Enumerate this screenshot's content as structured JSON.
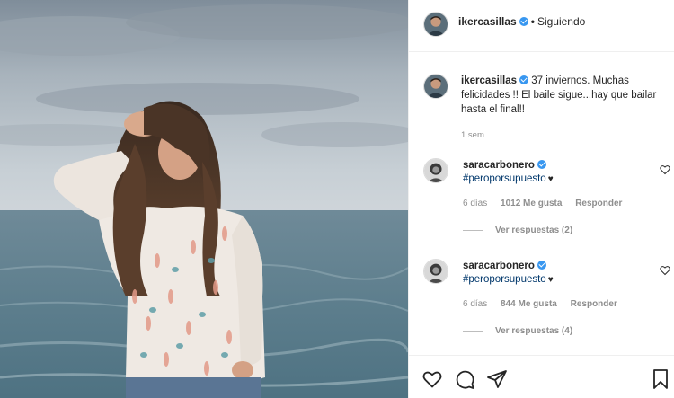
{
  "post": {
    "header": {
      "username": "ikercasillas",
      "separator": "•",
      "follow_status": "Siguiendo"
    },
    "caption": {
      "username": "ikercasillas",
      "text": "37 inviernos. Muchas felicidades !! El baile sigue...hay que bailar hasta el final!!",
      "time": "1 sem"
    },
    "comments": [
      {
        "username": "saracarbonero",
        "hashtag": "#peroporsupuesto",
        "emoji": "♥",
        "time": "6 días",
        "likes": "1012 Me gusta",
        "reply_label": "Responder",
        "replies_label": "Ver respuestas (2)"
      },
      {
        "username": "saracarbonero",
        "hashtag": "#peroporsupuesto",
        "emoji": "♥",
        "time": "6 días",
        "likes": "844 Me gusta",
        "reply_label": "Responder",
        "replies_label": "Ver respuestas (4)"
      }
    ],
    "icons": {
      "verified": "verified-badge-icon",
      "like": "heart-icon",
      "comment": "comment-icon",
      "share": "paper-plane-icon",
      "save": "bookmark-icon"
    },
    "colors": {
      "verified": "#3897f0",
      "hashtag": "#00376b",
      "muted": "#8e8e8e",
      "text": "#262626"
    }
  }
}
